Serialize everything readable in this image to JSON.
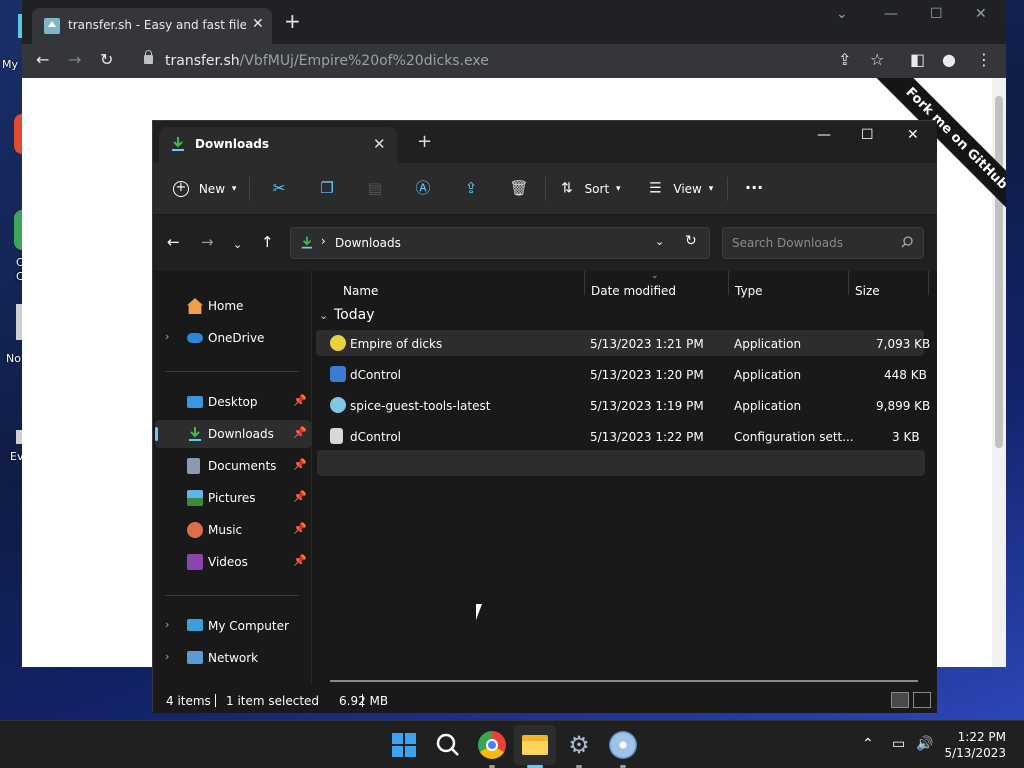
{
  "desktop": {
    "labels": [
      "My",
      "C",
      "C",
      "No",
      "Ev"
    ]
  },
  "browser": {
    "tab_title": "transfer.sh - Easy and fast file sharing",
    "url_host": "transfer.sh",
    "url_path": "/VbfMUj/Empire%20of%20dicks.exe",
    "ribbon_text": "Fork me on GitHub"
  },
  "explorer": {
    "tab_title": "Downloads",
    "commands": {
      "new": "New",
      "sort": "Sort",
      "view": "View"
    },
    "address": "Downloads",
    "search_placeholder": "Search Downloads",
    "sidebar": {
      "home": "Home",
      "onedrive": "OneDrive",
      "desktop": "Desktop",
      "downloads": "Downloads",
      "documents": "Documents",
      "pictures": "Pictures",
      "music": "Music",
      "videos": "Videos",
      "my_computer": "My Computer",
      "network": "Network"
    },
    "columns": {
      "name": "Name",
      "date": "Date modified",
      "type": "Type",
      "size": "Size"
    },
    "group": "Today",
    "files": [
      {
        "name": "Empire of dicks",
        "date": "5/13/2023 1:21 PM",
        "type": "Application",
        "size": "7,093 KB"
      },
      {
        "name": "dControl",
        "date": "5/13/2023 1:20 PM",
        "type": "Application",
        "size": "448 KB"
      },
      {
        "name": "spice-guest-tools-latest",
        "date": "5/13/2023 1:19 PM",
        "type": "Application",
        "size": "9,899 KB"
      },
      {
        "name": "dControl",
        "date": "5/13/2023 1:22 PM",
        "type": "Configuration sett...",
        "size": "3 KB"
      }
    ],
    "status": {
      "items": "4 items",
      "selected": "1 item selected",
      "size": "6.92 MB"
    }
  },
  "taskbar": {
    "time": "1:22 PM",
    "date": "5/13/2023"
  },
  "colors": {
    "accent": "#60cdff",
    "explorer_bg": "#191919",
    "selected_bg": "#2d2d2d"
  }
}
